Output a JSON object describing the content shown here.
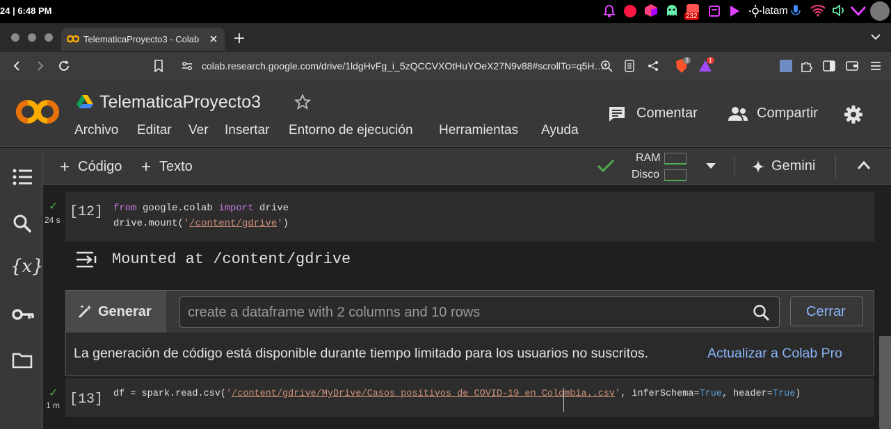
{
  "system": {
    "time": "24 | 6:48 PM",
    "badge_count": "232",
    "input_lang": "latam"
  },
  "browser": {
    "tab_title": "TelematicaProyecto3 - Colab",
    "url": "colab.research.google.com/drive/1ldgHvFg_i_5zQCCVXOtHuYOeX27N9v88#scrollTo=q5H…",
    "brave_badge": "3",
    "alert_badge": "1"
  },
  "colab": {
    "notebook_title": "TelematicaProyecto3",
    "menus": [
      "Archivo",
      "Editar",
      "Ver",
      "Insertar",
      "Entorno de ejecución",
      "Herramientas",
      "Ayuda"
    ],
    "comment_label": "Comentar",
    "share_label": "Compartir"
  },
  "toolbar": {
    "code_label": "Código",
    "text_label": "Texto",
    "ram_label": "RAM",
    "disk_label": "Disco",
    "gemini_label": "Gemini"
  },
  "cells": [
    {
      "exec_count": "[12]",
      "duration": "24 s",
      "line1": {
        "kw1": "from",
        "mod": " google.colab ",
        "kw2": "import",
        "name": " drive"
      },
      "line2": {
        "pre": "drive.mount(",
        "q1": "'",
        "str": "/content/gdrive",
        "q2": "'",
        "post": ")"
      },
      "output": "Mounted at /content/gdrive"
    },
    {
      "exec_count": "[13]",
      "duration": "1 m",
      "pre": "df = spark.read.csv(",
      "q1": "'",
      "str": "/content/gdrive/MyDrive/Casos_positivos_de_COVID-19_en_Colombia..csv",
      "q2": "'",
      "mid": ", inferSchema=",
      "b1": "True",
      "mid2": ", header=",
      "b2": "True",
      "post": ")"
    }
  ],
  "generate": {
    "button_label": "Generar",
    "placeholder": "create a dataframe with 2 columns and 10 rows",
    "close_label": "Cerrar",
    "notice": "La generación de código está disponible durante tiempo limitado para los usuarios no suscritos.",
    "upgrade_link": "Actualizar a Colab Pro"
  },
  "colors": {
    "colab_orange": "#f9ab00",
    "link_blue": "#8ab4f8",
    "success_green": "#4caf50"
  }
}
